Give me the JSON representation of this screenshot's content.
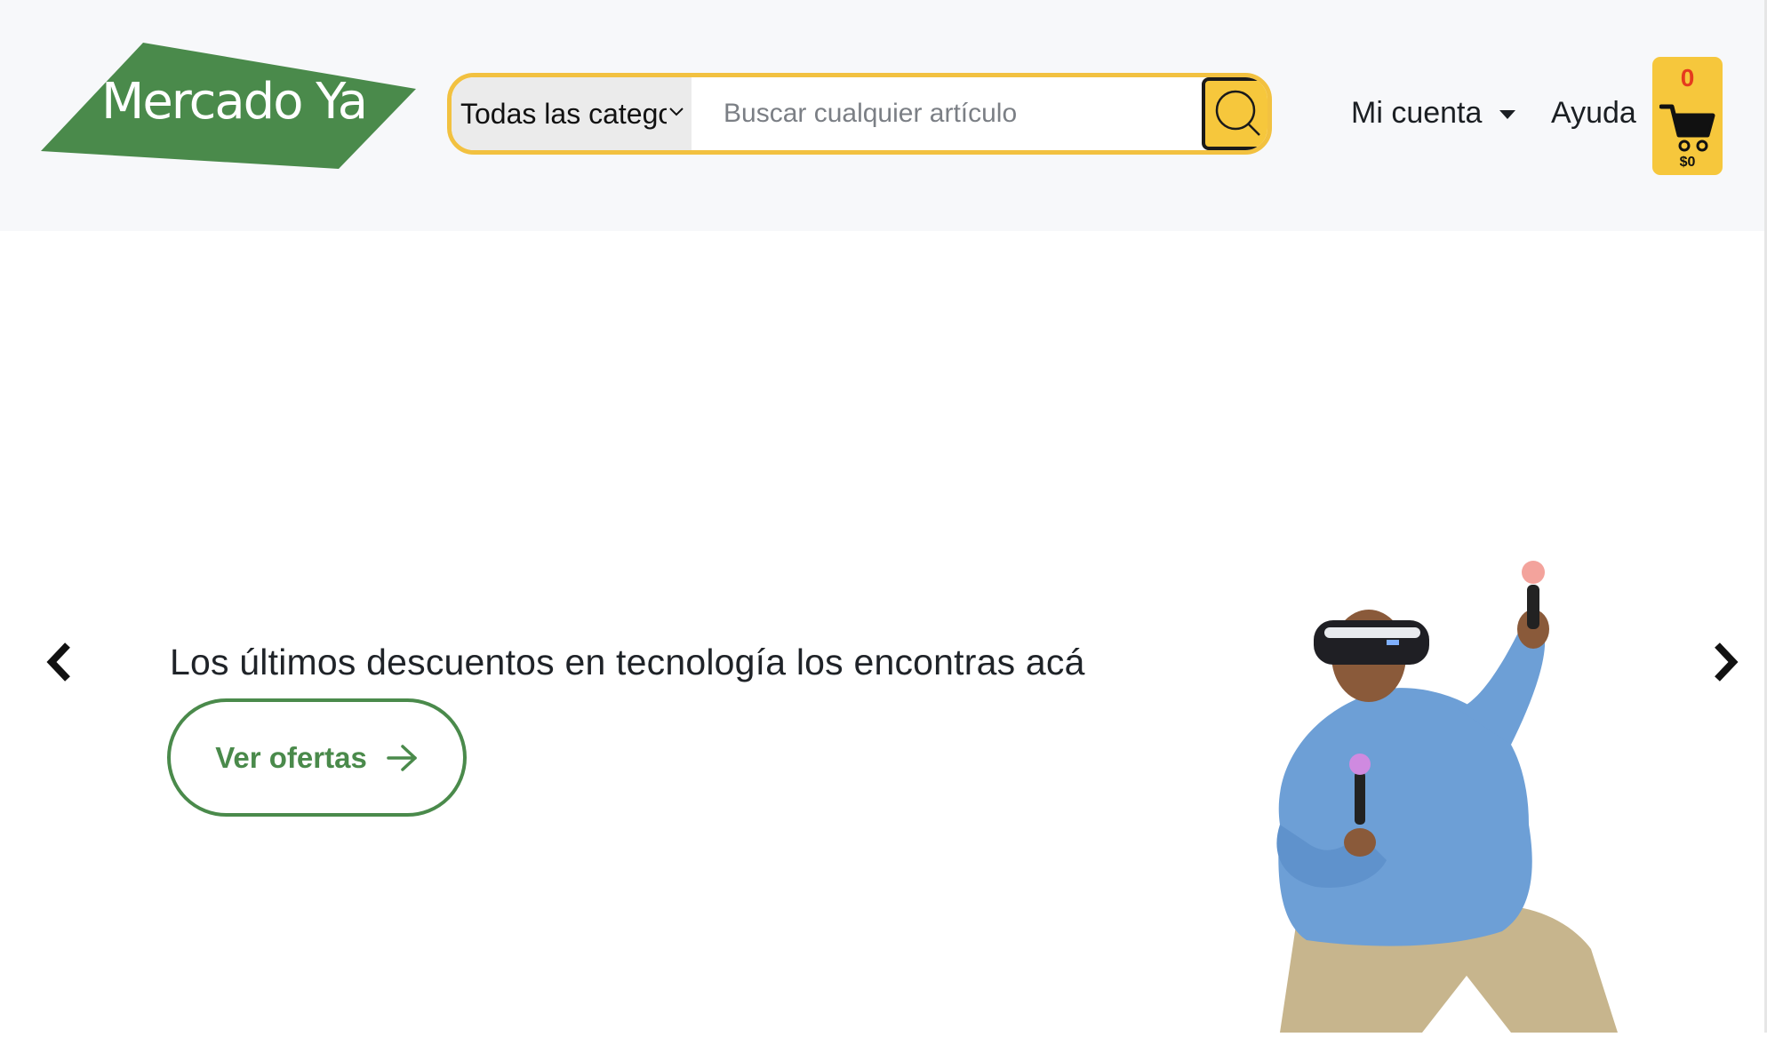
{
  "header": {
    "logo_text": "Mercado Ya",
    "search": {
      "category_label": "Todas las categorías",
      "placeholder": "Buscar cualquier artículo"
    },
    "nav": {
      "account_label": "Mi cuenta",
      "help_label": "Ayuda"
    },
    "cart": {
      "count": "0",
      "total": "$0"
    }
  },
  "hero": {
    "title": "Los últimos descuentos en tecnología los encontras acá",
    "cta_label": "Ver ofertas"
  },
  "colors": {
    "brand_green": "#4a8a4b",
    "accent_yellow": "#f6c73c",
    "search_border": "#f2c140",
    "cart_count_red": "#e53b1e",
    "header_bg": "#f7f8fa"
  },
  "icons": [
    "chevron-down-icon",
    "search-icon",
    "cart-icon",
    "arrow-right-icon",
    "chevron-left-icon",
    "chevron-right-icon"
  ]
}
